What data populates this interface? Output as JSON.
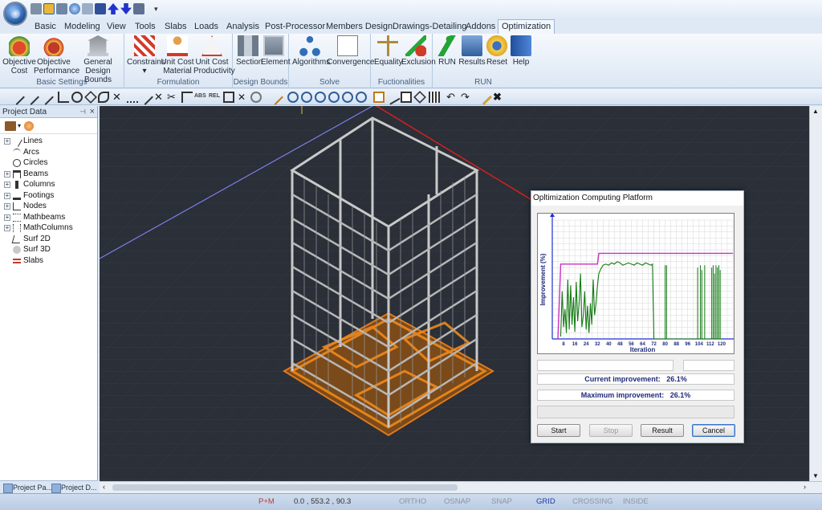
{
  "menu": {
    "tabs": [
      "Basic",
      "Modeling",
      "View",
      "Tools",
      "Slabs",
      "Loads",
      "Analysis",
      "Post-Processor",
      "Members Design",
      "Drawings-Detailing",
      "Addons",
      "Optimization"
    ]
  },
  "ribbon": {
    "groups": [
      {
        "label": "Basic Settings",
        "buttons": [
          [
            "Objective",
            "Cost"
          ],
          [
            "Objective",
            "Performance"
          ],
          [
            "General",
            "Design Bounds"
          ]
        ]
      },
      {
        "label": "Formulation",
        "buttons": [
          [
            "Constrains",
            ""
          ],
          [
            "Unit Cost",
            "Material"
          ],
          [
            "Unit Cost",
            "Productivity"
          ]
        ]
      },
      {
        "label": "Design Bounds",
        "buttons": [
          [
            "Section",
            ""
          ],
          [
            "Element",
            ""
          ]
        ]
      },
      {
        "label": "Solve",
        "buttons": [
          [
            "Algorithms",
            ""
          ],
          [
            "Convergence",
            ""
          ]
        ]
      },
      {
        "label": "Fuctionalities",
        "buttons": [
          [
            "Equality",
            ""
          ],
          [
            "Exclusion",
            ""
          ]
        ]
      },
      {
        "label": "RUN",
        "buttons": [
          [
            "RUN",
            ""
          ],
          [
            "Results",
            ""
          ],
          [
            "Reset",
            ""
          ],
          [
            "Help",
            ""
          ]
        ]
      }
    ]
  },
  "toolbar": {
    "abs_label": "ABS",
    "rel_label": "REL"
  },
  "project_panel": {
    "title": "Project Data",
    "items": [
      "Lines",
      "Arcs",
      "Circles",
      "Beams",
      "Columns",
      "Footings",
      "Nodes",
      "Mathbeams",
      "MathColumns",
      "Surf 2D",
      "Surf 3D",
      "Slabs"
    ],
    "bottom_tabs": [
      "Project Pa...",
      "Project D..."
    ]
  },
  "status": {
    "mode": "P+M",
    "coords": "0.0 , 553.2 , 90.3",
    "ortho": "ORTHO",
    "osnap": "OSNAP",
    "snap": "SNAP",
    "grid": "GRID",
    "crossing": "CROSSING",
    "inside": "INSIDE"
  },
  "dialog": {
    "title": "Opltimization Computing Platform",
    "current_label": "Current improvement:",
    "current_value": "26.1%",
    "max_label": "Maximum improvement:",
    "max_value": "26.1%",
    "buttons": {
      "start": "Start",
      "stop": "Stop",
      "result": "Result",
      "cancel": "Cancel"
    }
  },
  "colors": {
    "accent": "#3b74c7",
    "ribbon_bg": "#dfe9f6",
    "viewport": "#2a2f38",
    "max_line": "#cc2fc7",
    "current_line": "#137a13"
  },
  "chart_data": {
    "type": "line",
    "xlabel": "Iteration",
    "ylabel": "Improvement (%)",
    "x_ticks": [
      8,
      16,
      24,
      32,
      40,
      48,
      56,
      64,
      72,
      80,
      88,
      96,
      104,
      112,
      120
    ],
    "xlim": [
      0,
      128
    ],
    "ylim": [
      0,
      100
    ],
    "grid": true,
    "series": [
      {
        "color": "#cc2fc7",
        "x": [
          4,
          6,
          32,
          33,
          128
        ],
        "y": [
          0,
          63,
          63,
          72,
          72
        ]
      },
      {
        "color": "#137a13",
        "x": [
          6,
          7,
          8,
          9,
          10,
          11,
          12,
          13,
          14,
          15,
          16,
          17,
          18,
          19,
          20,
          21,
          22,
          23,
          24,
          25,
          26,
          27,
          28,
          29,
          30,
          31,
          32,
          33,
          34,
          35,
          36,
          38,
          40,
          42,
          44,
          46,
          48,
          50,
          52,
          54,
          56,
          58,
          60,
          62,
          64,
          66,
          68,
          70,
          71,
          72,
          73,
          74,
          75,
          76,
          77,
          78,
          79,
          80,
          81,
          82,
          83,
          84,
          85,
          86,
          87,
          88,
          89,
          90,
          91,
          92,
          93,
          94,
          95,
          96,
          97,
          98,
          99,
          100,
          101,
          102,
          103,
          104,
          105,
          106,
          107,
          108,
          109,
          110,
          111,
          112,
          113,
          114,
          115,
          116,
          117,
          118,
          119,
          120
        ],
        "y": [
          2,
          40,
          10,
          25,
          5,
          50,
          8,
          45,
          12,
          35,
          6,
          48,
          15,
          30,
          55,
          10,
          20,
          40,
          8,
          28,
          5,
          30,
          12,
          50,
          20,
          30,
          45,
          55,
          58,
          60,
          62,
          63,
          62,
          64,
          63,
          65,
          64,
          62,
          63,
          64,
          63,
          62,
          64,
          63,
          62,
          64,
          63,
          62,
          63,
          0,
          0,
          0,
          0,
          0,
          0,
          0,
          0,
          0,
          0,
          0,
          0,
          0,
          0,
          0,
          0,
          0,
          0,
          0,
          0,
          0,
          0,
          0,
          0,
          0,
          0,
          0,
          0,
          0,
          0,
          0,
          0,
          0,
          0,
          0,
          0,
          0,
          0,
          0,
          0,
          0,
          0,
          0,
          0,
          0,
          0,
          0,
          0,
          0
        ]
      }
    ]
  }
}
